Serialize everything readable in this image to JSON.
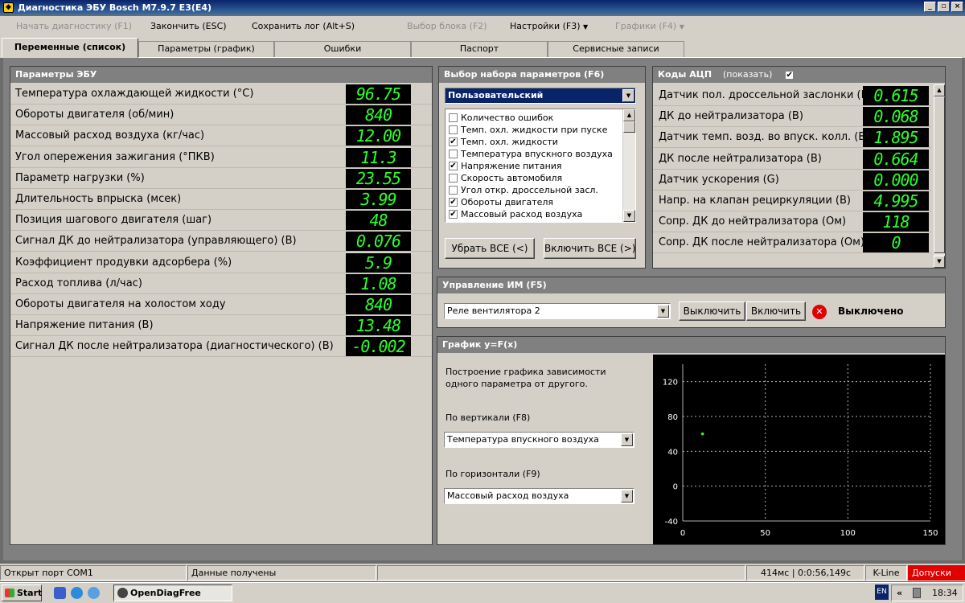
{
  "window": {
    "title": "Диагностика ЭБУ Bosch M7.9.7 E3(E4)"
  },
  "menu": {
    "start_diag": "Начать диагностику (F1)",
    "finish": "Закончить (ESC)",
    "save_log": "Сохранить лог (Alt+S)",
    "select_block": "Выбор блока (F2)",
    "settings": "Настройки (F3)",
    "graphs": "Графики (F4)"
  },
  "tabs": [
    "Переменные (список)",
    "Параметры (график)",
    "Ошибки",
    "Паспорт",
    "Сервисные записи"
  ],
  "ecu_params": {
    "title": "Параметры ЭБУ",
    "rows": [
      {
        "label": "Температура охлаждающей жидкости (°C)",
        "value": "96.75"
      },
      {
        "label": "Обороты двигателя (об/мин)",
        "value": "840"
      },
      {
        "label": "Массовый расход воздуха (кг/час)",
        "value": "12.00"
      },
      {
        "label": "Угол опережения зажигания (°ПКВ)",
        "value": "11.3"
      },
      {
        "label": "Параметр нагрузки (%)",
        "value": "23.55"
      },
      {
        "label": "Длительность впрыска (мсек)",
        "value": "3.99"
      },
      {
        "label": "Позиция шагового двигателя (шаг)",
        "value": "48"
      },
      {
        "label": "Сигнал ДК до нейтрализатора (управляющего) (В)",
        "value": "0.076"
      },
      {
        "label": "Коэффициент продувки адсорбера (%)",
        "value": "5.9"
      },
      {
        "label": "Расход топлива (л/час)",
        "value": "1.08"
      },
      {
        "label": "Обороты двигателя на холостом ходу",
        "value": "840"
      },
      {
        "label": "Напряжение питания (В)",
        "value": "13.48"
      },
      {
        "label": "Сигнал ДК после нейтрализатора (диагностического) (В)",
        "value": "-0.002"
      }
    ]
  },
  "param_set": {
    "title": "Выбор набора параметров (F6)",
    "selected": "Пользовательский",
    "items": [
      {
        "label": "Количество ошибок",
        "checked": false
      },
      {
        "label": "Темп. охл. жидкости при пуске",
        "checked": false
      },
      {
        "label": "Темп. охл. жидкости",
        "checked": true
      },
      {
        "label": "Температура впускного воздуха",
        "checked": false
      },
      {
        "label": "Напряжение питания",
        "checked": true
      },
      {
        "label": "Скорость автомобиля",
        "checked": false
      },
      {
        "label": "Угол откр. дроссельной засл.",
        "checked": false
      },
      {
        "label": "Обороты двигателя",
        "checked": true
      },
      {
        "label": "Массовый расход воздуха",
        "checked": true
      }
    ],
    "remove_all": "Убрать ВСЕ (<)",
    "include_all": "Включить ВСЕ (>)"
  },
  "adc": {
    "title": "Коды АЦП",
    "show_label": "(показать)",
    "show_checked": true,
    "rows": [
      {
        "label": "Датчик пол. дроссельной заслонки (В)",
        "value": "0.615"
      },
      {
        "label": "ДК до нейтрализатора (В)",
        "value": "0.068"
      },
      {
        "label": "Датчик темп. возд. во впуск. колл. (В)",
        "value": "1.895"
      },
      {
        "label": "ДК после нейтрализатора (В)",
        "value": "0.664"
      },
      {
        "label": "Датчик ускорения (G)",
        "value": "0.000"
      },
      {
        "label": "Напр. на клапан рециркуляции (В)",
        "value": "4.995"
      },
      {
        "label": "Сопр. ДК до нейтрализатора (Ом)",
        "value": "118"
      },
      {
        "label": "Сопр. ДК после нейтрализатора (Ом)",
        "value": "0"
      }
    ]
  },
  "control": {
    "title": "Управление ИМ (F5)",
    "selected": "Реле вентилятора 2",
    "off_btn": "Выключить",
    "on_btn": "Включить",
    "status": "Выключено"
  },
  "graph_panel": {
    "title": "График y=F(x)",
    "description": "Построение графика зависимости одного параметра от другого.",
    "vertical_label": "По вертикали (F8)",
    "vertical_value": "Температура впускного воздуха",
    "horizontal_label": "По горизонтали (F9)",
    "horizontal_value": "Массовый расход воздуха"
  },
  "chart_data": {
    "type": "scatter",
    "x": [
      12.0
    ],
    "y": [
      60
    ],
    "xlim": [
      0,
      150
    ],
    "ylim": [
      -40,
      140
    ],
    "x_ticks": [
      "0",
      "50",
      "100",
      "150"
    ],
    "y_ticks": [
      "-40",
      "0",
      "40",
      "80",
      "120"
    ],
    "grid": true,
    "colors": {
      "background": "#000000",
      "grid": "#b0b0b0",
      "point": "#2bff2b",
      "text": "#ffffff"
    }
  },
  "status": {
    "port": "Открыт порт COM1",
    "data": "Данные получены",
    "timing": "414мс | 0:0:56,149с",
    "protocol": "K-Line",
    "tolerance": "Допуски"
  },
  "taskbar": {
    "start": "Start",
    "task": "OpenDiagFree",
    "lang": "EN",
    "time": "18:34"
  },
  "colors": {
    "led_text": "#2bff2b",
    "led_bg": "#000000",
    "title_bar": "#0a246a",
    "alert": "#e00000"
  }
}
